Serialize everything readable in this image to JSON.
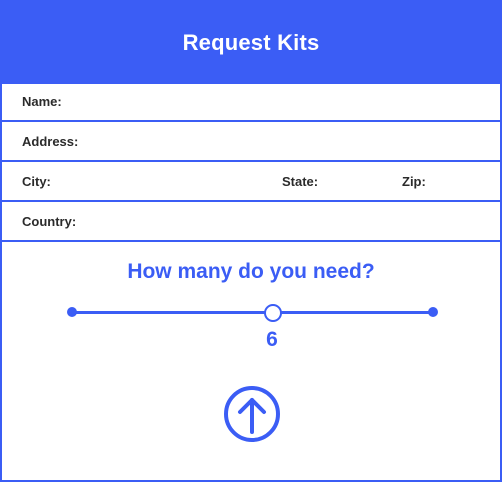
{
  "header": {
    "title": "Request Kits"
  },
  "form": {
    "name_label": "Name:",
    "address_label": "Address:",
    "city_label": "City:",
    "state_label": "State:",
    "zip_label": "Zip:",
    "country_label": "Country:",
    "name_value": "",
    "address_value": "",
    "city_value": "",
    "state_value": "",
    "zip_value": "",
    "country_value": ""
  },
  "quantity": {
    "question": "How many do you need?",
    "value": "6"
  },
  "submit": {
    "icon": "arrow-up-circle-icon"
  },
  "colors": {
    "accent": "#3b5df5",
    "text": "#2b2b2b",
    "background": "#ffffff"
  }
}
